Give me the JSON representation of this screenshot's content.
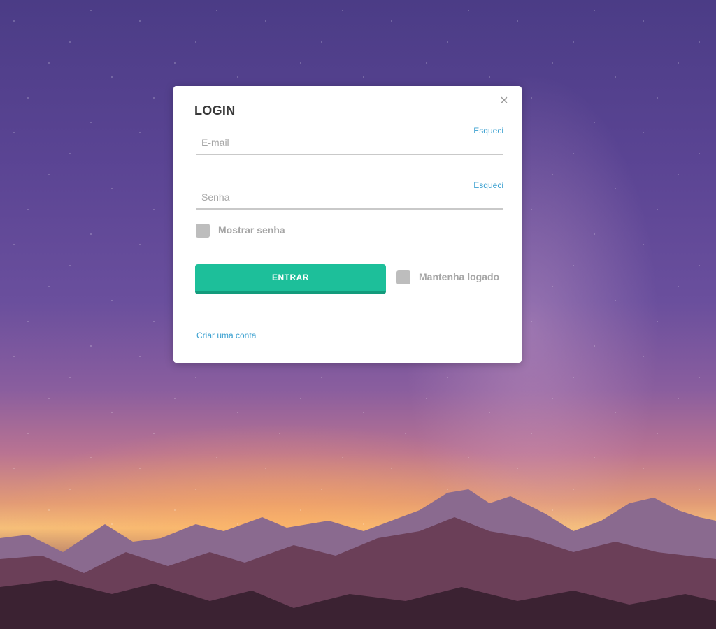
{
  "login": {
    "title": "LOGIN",
    "close_glyph": "×",
    "email": {
      "forgot_label": "Esqueci",
      "placeholder": "E-mail",
      "value": ""
    },
    "password": {
      "forgot_label": "Esqueci",
      "placeholder": "Senha",
      "value": ""
    },
    "show_password_label": "Mostrar senha",
    "submit_label": "ENTRAR",
    "keep_logged_label": "Mantenha logado",
    "create_account_label": "Criar uma conta"
  },
  "icons": {
    "close": "close-icon"
  },
  "colors": {
    "accent": "#1dbf9a",
    "link": "#3aa0d0",
    "checkbox": "#bdbdbd"
  }
}
